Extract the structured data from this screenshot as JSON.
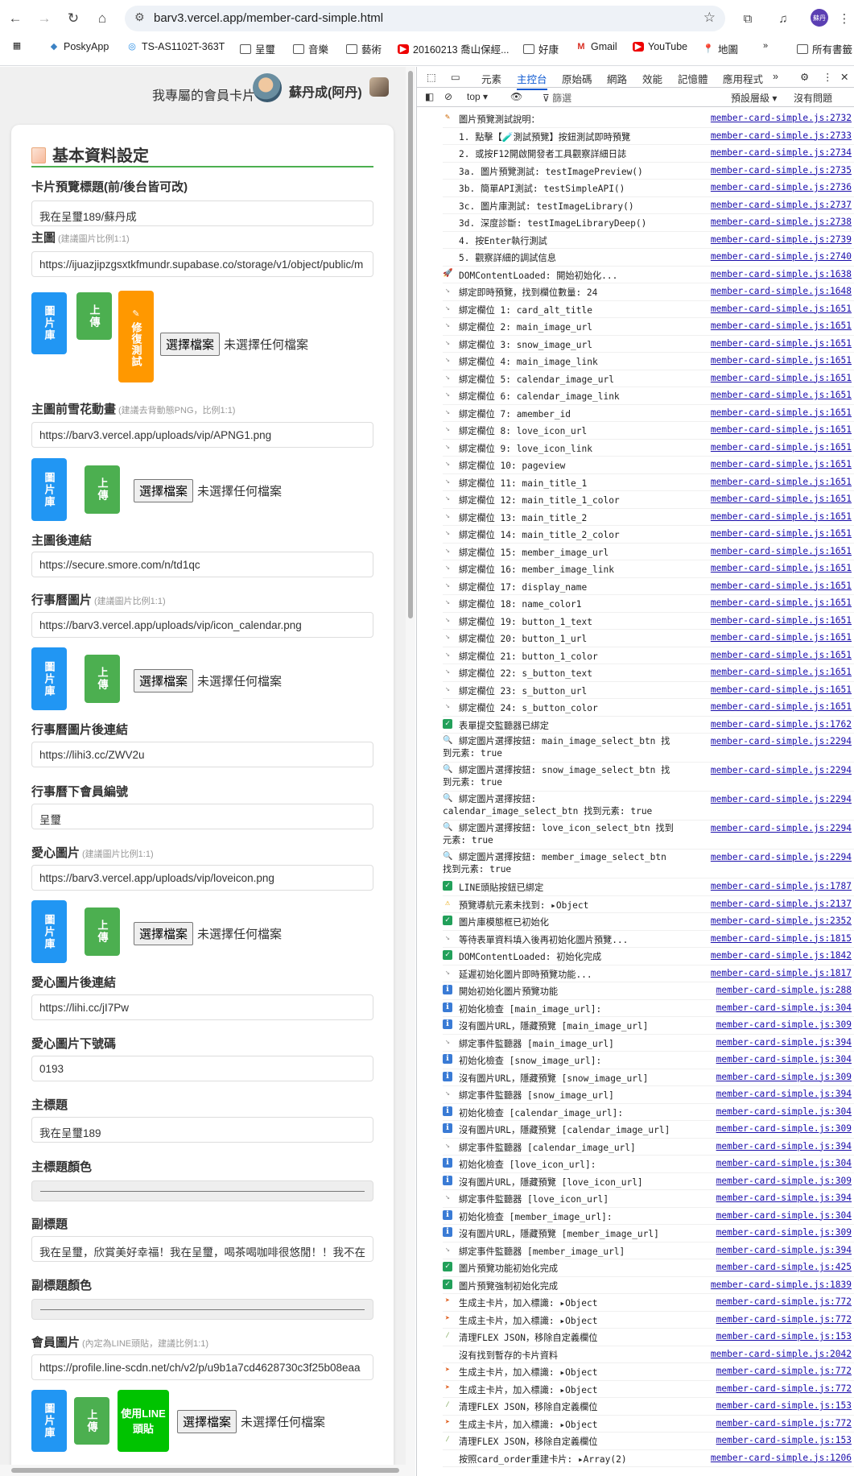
{
  "browser": {
    "url": "barv3.vercel.app/member-card-simple.html",
    "profile_initials": "蘇丹",
    "bookmarks": [
      {
        "label": "PoskyApp",
        "icon": "lizard-icon"
      },
      {
        "label": "TS-AS1102T-363T",
        "icon": "nas-icon"
      },
      {
        "label": "呈璽",
        "icon": "folder-icon"
      },
      {
        "label": "音樂",
        "icon": "folder-icon"
      },
      {
        "label": "藝術",
        "icon": "folder-icon"
      },
      {
        "label": "20160213 喬山保經...",
        "icon": "youtube-icon"
      },
      {
        "label": "好康",
        "icon": "folder-icon"
      },
      {
        "label": "Gmail",
        "icon": "gmail-icon"
      },
      {
        "label": "YouTube",
        "icon": "youtube-icon"
      },
      {
        "label": "地圖",
        "icon": "maps-icon"
      },
      {
        "label": "所有書籤",
        "icon": "folder-icon"
      }
    ]
  },
  "header": {
    "title": "我專屬的會員卡片",
    "user_name": "蘇丹成(阿丹)"
  },
  "form": {
    "section_title": "基本資料設定",
    "fields": {
      "card_alt_title": {
        "label": "卡片預覽標題(前/後台皆可改)",
        "value": "我在呈璽189/蘇丹成"
      },
      "main_image": {
        "label": "主圖",
        "hint": "(建議圖片比例1:1)",
        "value": "https://ijuazjipzgsxtkfmundr.supabase.co/storage/v1/object/public/m"
      },
      "snow_image": {
        "label": "主圖前雪花動畫",
        "hint": "(建議去背動態PNG，比例1:1)",
        "value": "https://barv3.vercel.app/uploads/vip/APNG1.png"
      },
      "main_image_link": {
        "label": "主圖後連結",
        "value": "https://secure.smore.com/n/td1qc"
      },
      "calendar_image": {
        "label": "行事曆圖片",
        "hint": "(建議圖片比例1:1)",
        "value": "https://barv3.vercel.app/uploads/vip/icon_calendar.png"
      },
      "calendar_image_link": {
        "label": "行事曆圖片後連結",
        "value": "https://lihi3.cc/ZWV2u"
      },
      "amember_id": {
        "label": "行事曆下會員編號",
        "value": "呈璽"
      },
      "love_icon": {
        "label": "愛心圖片",
        "hint": "(建議圖片比例1:1)",
        "value": "https://barv3.vercel.app/uploads/vip/loveicon.png"
      },
      "love_icon_link": {
        "label": "愛心圖片後連結",
        "value": "https://lihi.cc/jI7Pw"
      },
      "pageview": {
        "label": "愛心圖片下號碼",
        "value": "0193"
      },
      "main_title_1": {
        "label": "主標題",
        "value": "我在呈璽189"
      },
      "main_title_1_color": {
        "label": "主標題顏色"
      },
      "main_title_2": {
        "label": "副標題",
        "value": "我在呈璽，欣賞美好幸福！我在呈璽，喝茶喝咖啡很悠閒！！我不在"
      },
      "main_title_2_color": {
        "label": "副標題顏色"
      },
      "member_image": {
        "label": "會員圖片",
        "hint": "(內定為LINE頭貼，建議比例1:1)",
        "value": "https://profile.line-scdn.net/ch/v2/p/u9b1a7cd4628730c3f25b08eaa"
      }
    },
    "buttons": {
      "library": "圖片庫",
      "upload": "上傳",
      "fix_test": "修復測試",
      "line_avatar": "使用LINE頭貼",
      "choose_file": "選擇檔案",
      "no_file": "未選擇任何檔案"
    }
  },
  "devtools": {
    "tabs": [
      "元素",
      "主控台",
      "原始碼",
      "網路",
      "效能",
      "記憶體",
      "應用程式"
    ],
    "active_tab": "主控台",
    "context": "top",
    "filter_placeholder": "篩選",
    "levels": "預設層級",
    "issues": "沒有問題",
    "console": [
      {
        "icon": "pencil",
        "text": "圖片預覽測試說明：",
        "src": "member-card-simple.js:2732"
      },
      {
        "icon": "",
        "text": "1. 點擊【🧪測試預覽】按鈕測試即時預覽",
        "src": "member-card-simple.js:2733"
      },
      {
        "icon": "",
        "text": "2. 或按F12開啟開發者工具觀察詳細日誌",
        "src": "member-card-simple.js:2734"
      },
      {
        "icon": "",
        "text": "3a. 圖片預覽測試: testImagePreview()",
        "src": "member-card-simple.js:2735"
      },
      {
        "icon": "",
        "text": "3b. 簡單API測試: testSimpleAPI()",
        "src": "member-card-simple.js:2736"
      },
      {
        "icon": "",
        "text": "3c. 圖片庫測試: testImageLibrary()",
        "src": "member-card-simple.js:2737"
      },
      {
        "icon": "",
        "text": "3d. 深度診斷: testImageLibraryDeep()",
        "src": "member-card-simple.js:2738"
      },
      {
        "icon": "",
        "text": "4. 按Enter執行測試",
        "src": "member-card-simple.js:2739"
      },
      {
        "icon": "",
        "text": "5. 觀察詳細的調試信息",
        "src": "member-card-simple.js:2740"
      },
      {
        "icon": "rocket",
        "text": "DOMContentLoaded: 開始初始化...",
        "src": "member-card-simple.js:1638"
      },
      {
        "icon": "link",
        "text": "綁定即時預覽，找到欄位數量: 24",
        "src": "member-card-simple.js:1648"
      },
      {
        "icon": "link",
        "text": "綁定欄位 1: card_alt_title",
        "src": "member-card-simple.js:1651"
      },
      {
        "icon": "link",
        "text": "綁定欄位 2: main_image_url",
        "src": "member-card-simple.js:1651"
      },
      {
        "icon": "link",
        "text": "綁定欄位 3: snow_image_url",
        "src": "member-card-simple.js:1651"
      },
      {
        "icon": "link",
        "text": "綁定欄位 4: main_image_link",
        "src": "member-card-simple.js:1651"
      },
      {
        "icon": "link",
        "text": "綁定欄位 5: calendar_image_url",
        "src": "member-card-simple.js:1651"
      },
      {
        "icon": "link",
        "text": "綁定欄位 6: calendar_image_link",
        "src": "member-card-simple.js:1651"
      },
      {
        "icon": "link",
        "text": "綁定欄位 7: amember_id",
        "src": "member-card-simple.js:1651"
      },
      {
        "icon": "link",
        "text": "綁定欄位 8: love_icon_url",
        "src": "member-card-simple.js:1651"
      },
      {
        "icon": "link",
        "text": "綁定欄位 9: love_icon_link",
        "src": "member-card-simple.js:1651"
      },
      {
        "icon": "link",
        "text": "綁定欄位 10: pageview",
        "src": "member-card-simple.js:1651"
      },
      {
        "icon": "link",
        "text": "綁定欄位 11: main_title_1",
        "src": "member-card-simple.js:1651"
      },
      {
        "icon": "link",
        "text": "綁定欄位 12: main_title_1_color",
        "src": "member-card-simple.js:1651"
      },
      {
        "icon": "link",
        "text": "綁定欄位 13: main_title_2",
        "src": "member-card-simple.js:1651"
      },
      {
        "icon": "link",
        "text": "綁定欄位 14: main_title_2_color",
        "src": "member-card-simple.js:1651"
      },
      {
        "icon": "link",
        "text": "綁定欄位 15: member_image_url",
        "src": "member-card-simple.js:1651"
      },
      {
        "icon": "link",
        "text": "綁定欄位 16: member_image_link",
        "src": "member-card-simple.js:1651"
      },
      {
        "icon": "link",
        "text": "綁定欄位 17: display_name",
        "src": "member-card-simple.js:1651"
      },
      {
        "icon": "link",
        "text": "綁定欄位 18: name_color1",
        "src": "member-card-simple.js:1651"
      },
      {
        "icon": "link",
        "text": "綁定欄位 19: button_1_text",
        "src": "member-card-simple.js:1651"
      },
      {
        "icon": "link",
        "text": "綁定欄位 20: button_1_url",
        "src": "member-card-simple.js:1651"
      },
      {
        "icon": "link",
        "text": "綁定欄位 21: button_1_color",
        "src": "member-card-simple.js:1651"
      },
      {
        "icon": "link",
        "text": "綁定欄位 22: s_button_text",
        "src": "member-card-simple.js:1651"
      },
      {
        "icon": "link",
        "text": "綁定欄位 23: s_button_url",
        "src": "member-card-simple.js:1651"
      },
      {
        "icon": "link",
        "text": "綁定欄位 24: s_button_color",
        "src": "member-card-simple.js:1651"
      },
      {
        "icon": "ok",
        "text": "表單提交監聽器已綁定",
        "src": "member-card-simple.js:1762"
      },
      {
        "icon": "search",
        "text": "綁定圖片選擇按鈕: main_image_select_btn 找到元素: true",
        "src": "member-card-simple.js:2294",
        "tall": true
      },
      {
        "icon": "search",
        "text": "綁定圖片選擇按鈕: snow_image_select_btn 找到元素: true",
        "src": "member-card-simple.js:2294",
        "tall": true
      },
      {
        "icon": "search",
        "text": "綁定圖片選擇按鈕: calendar_image_select_btn 找到元素: true",
        "src": "member-card-simple.js:2294",
        "tall": true
      },
      {
        "icon": "search",
        "text": "綁定圖片選擇按鈕: love_icon_select_btn 找到元素: true",
        "src": "member-card-simple.js:2294",
        "tall": true
      },
      {
        "icon": "search",
        "text": "綁定圖片選擇按鈕: member_image_select_btn 找到元素: true",
        "src": "member-card-simple.js:2294",
        "tall": true
      },
      {
        "icon": "ok",
        "text": "LINE頭貼按鈕已綁定",
        "src": "member-card-simple.js:1787"
      },
      {
        "icon": "warn",
        "text": "預覽導航元素未找到: ▸Object",
        "src": "member-card-simple.js:2137"
      },
      {
        "icon": "ok",
        "text": "圖片庫模態框已初始化",
        "src": "member-card-simple.js:2352"
      },
      {
        "icon": "link",
        "text": "等待表單資料填入後再初始化圖片預覽...",
        "src": "member-card-simple.js:1815"
      },
      {
        "icon": "ok",
        "text": "DOMContentLoaded: 初始化完成",
        "src": "member-card-simple.js:1842"
      },
      {
        "icon": "link",
        "text": "延遲初始化圖片即時預覽功能...",
        "src": "member-card-simple.js:1817"
      },
      {
        "icon": "info",
        "text": "開始初始化圖片預覽功能",
        "src": "member-card-simple.js:288"
      },
      {
        "icon": "info",
        "text": "初始化檢查 [main_image_url]:",
        "src": "member-card-simple.js:304"
      },
      {
        "icon": "info",
        "text": "沒有圖片URL，隱藏預覽 [main_image_url]",
        "src": "member-card-simple.js:309"
      },
      {
        "icon": "link",
        "text": "綁定事件監聽器 [main_image_url]",
        "src": "member-card-simple.js:394"
      },
      {
        "icon": "info",
        "text": "初始化檢查 [snow_image_url]:",
        "src": "member-card-simple.js:304"
      },
      {
        "icon": "info",
        "text": "沒有圖片URL，隱藏預覽 [snow_image_url]",
        "src": "member-card-simple.js:309"
      },
      {
        "icon": "link",
        "text": "綁定事件監聽器 [snow_image_url]",
        "src": "member-card-simple.js:394"
      },
      {
        "icon": "info",
        "text": "初始化檢查 [calendar_image_url]:",
        "src": "member-card-simple.js:304"
      },
      {
        "icon": "info",
        "text": "沒有圖片URL，隱藏預覽 [calendar_image_url]",
        "src": "member-card-simple.js:309"
      },
      {
        "icon": "link",
        "text": "綁定事件監聽器 [calendar_image_url]",
        "src": "member-card-simple.js:394"
      },
      {
        "icon": "info",
        "text": "初始化檢查 [love_icon_url]:",
        "src": "member-card-simple.js:304"
      },
      {
        "icon": "info",
        "text": "沒有圖片URL，隱藏預覽 [love_icon_url]",
        "src": "member-card-simple.js:309"
      },
      {
        "icon": "link",
        "text": "綁定事件監聽器 [love_icon_url]",
        "src": "member-card-simple.js:394"
      },
      {
        "icon": "info",
        "text": "初始化檢查 [member_image_url]:",
        "src": "member-card-simple.js:304"
      },
      {
        "icon": "info",
        "text": "沒有圖片URL，隱藏預覽 [member_image_url]",
        "src": "member-card-simple.js:309"
      },
      {
        "icon": "link",
        "text": "綁定事件監聽器 [member_image_url]",
        "src": "member-card-simple.js:394"
      },
      {
        "icon": "ok",
        "text": "圖片預覽功能初始化完成",
        "src": "member-card-simple.js:425"
      },
      {
        "icon": "ok",
        "text": "圖片預覽強制初始化完成",
        "src": "member-card-simple.js:1839"
      },
      {
        "icon": "flag",
        "text": "生成主卡片，加入標識: ▸Object",
        "src": "member-card-simple.js:772"
      },
      {
        "icon": "flag",
        "text": "生成主卡片，加入標識: ▸Object",
        "src": "member-card-simple.js:772"
      },
      {
        "icon": "tool",
        "text": "清理FLEX JSON，移除自定義欄位",
        "src": "member-card-simple.js:153"
      },
      {
        "icon": "",
        "text": "沒有找到暫存的卡片資料",
        "src": "member-card-simple.js:2042"
      },
      {
        "icon": "flag",
        "text": "生成主卡片，加入標識: ▸Object",
        "src": "member-card-simple.js:772"
      },
      {
        "icon": "flag",
        "text": "生成主卡片，加入標識: ▸Object",
        "src": "member-card-simple.js:772"
      },
      {
        "icon": "tool",
        "text": "清理FLEX JSON，移除自定義欄位",
        "src": "member-card-simple.js:153"
      },
      {
        "icon": "flag",
        "text": "生成主卡片，加入標識: ▸Object",
        "src": "member-card-simple.js:772"
      },
      {
        "icon": "tool",
        "text": "清理FLEX JSON，移除自定義欄位",
        "src": "member-card-simple.js:153"
      },
      {
        "icon": "",
        "text": "按照card_order重建卡片: ▸Array(2)",
        "src": "member-card-simple.js:1206"
      }
    ]
  }
}
